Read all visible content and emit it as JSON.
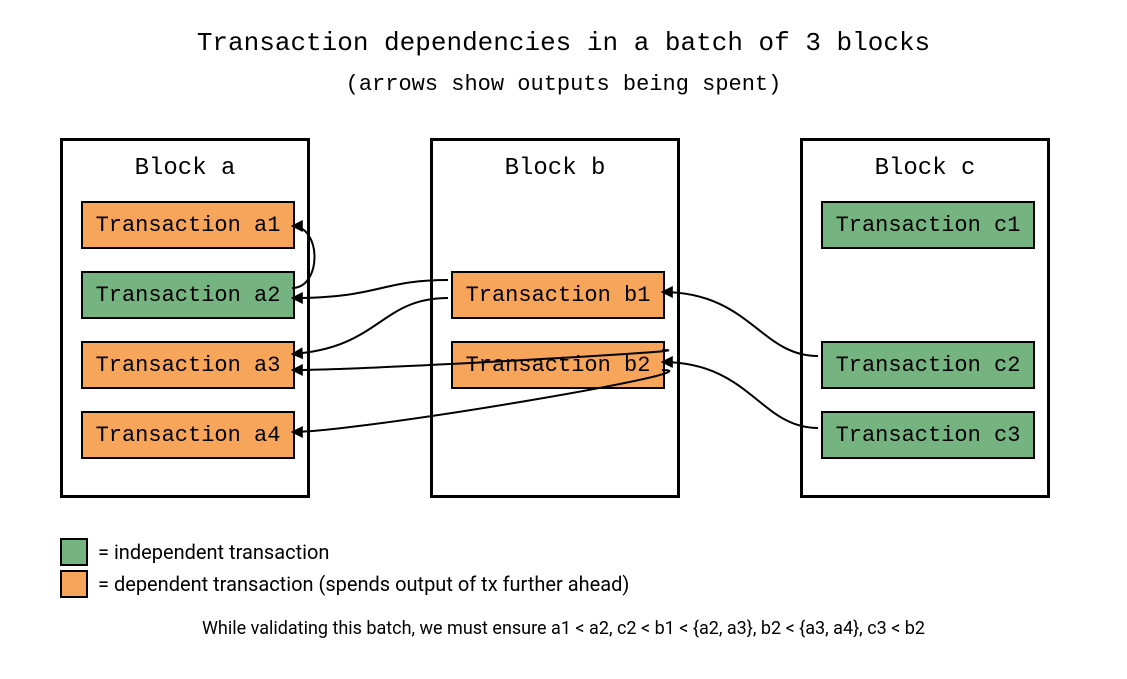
{
  "title": "Transaction dependencies in a batch of 3 blocks",
  "subtitle": "(arrows show outputs being spent)",
  "legend": {
    "green": "= independent transaction",
    "orange": "= dependent transaction (spends output of tx further ahead)"
  },
  "footer": "While validating this batch, we must ensure a1 < a2, c2 < b1 < {a2, a3}, b2 < {a3, a4}, c3 < b2",
  "blocks": {
    "a": {
      "title": "Block a"
    },
    "b": {
      "title": "Block b"
    },
    "c": {
      "title": "Block c"
    }
  },
  "tx": {
    "a1": "Transaction a1",
    "a2": "Transaction a2",
    "a3": "Transaction a3",
    "a4": "Transaction a4",
    "b1": "Transaction b1",
    "b2": "Transaction b2",
    "c1": "Transaction c1",
    "c2": "Transaction c2",
    "c3": "Transaction c3"
  },
  "colors": {
    "green": "#75B480",
    "orange": "#F7A55B"
  },
  "edges": [
    {
      "from": "a2",
      "to": "a1"
    },
    {
      "from": "b1",
      "to": "a2"
    },
    {
      "from": "b1",
      "to": "a3"
    },
    {
      "from": "b2",
      "to": "a3"
    },
    {
      "from": "b2",
      "to": "a4"
    },
    {
      "from": "c2",
      "to": "b1"
    },
    {
      "from": "c3",
      "to": "b2"
    }
  ]
}
